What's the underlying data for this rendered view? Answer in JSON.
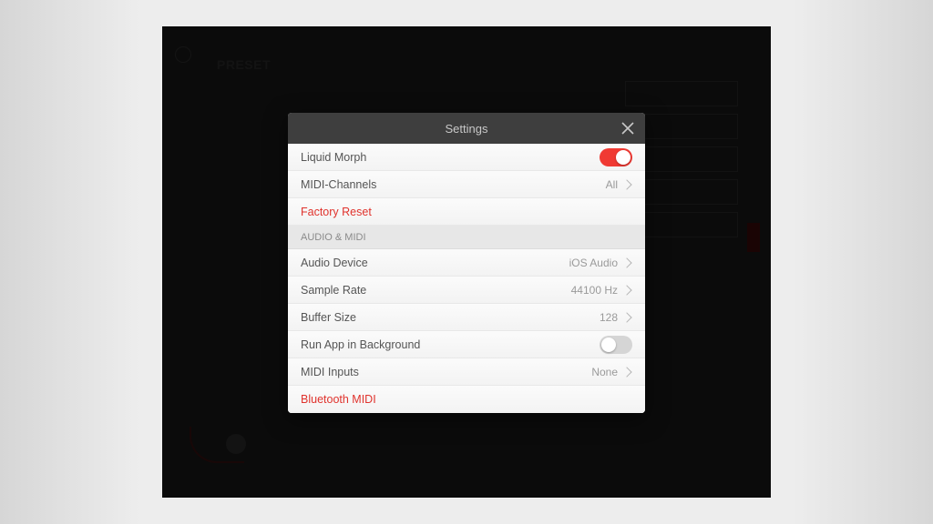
{
  "modal": {
    "title": "Settings",
    "rows": {
      "liquid_morph": {
        "label": "Liquid Morph",
        "on": true
      },
      "midi_channels": {
        "label": "MIDI-Channels",
        "value": "All"
      },
      "factory_reset": {
        "label": "Factory Reset"
      },
      "section_audio": {
        "label": "AUDIO & MIDI"
      },
      "audio_device": {
        "label": "Audio Device",
        "value": "iOS Audio"
      },
      "sample_rate": {
        "label": "Sample Rate",
        "value": "44100 Hz"
      },
      "buffer_size": {
        "label": "Buffer Size",
        "value": "128"
      },
      "run_bg": {
        "label": "Run App in Background",
        "on": false
      },
      "midi_inputs": {
        "label": "MIDI Inputs",
        "value": "None"
      },
      "bt_midi": {
        "label": "Bluetooth MIDI"
      }
    }
  },
  "background": {
    "title_hint": "PRESET"
  }
}
